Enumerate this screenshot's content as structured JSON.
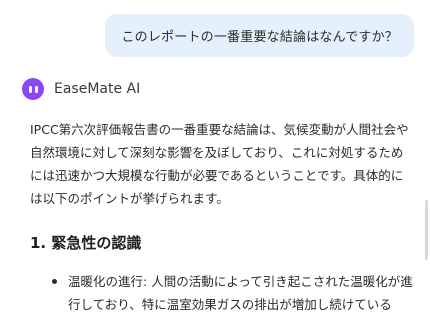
{
  "user_message": "このレポートの一番重要な結論はなんですか？",
  "assistant": {
    "name": "EaseMate AI",
    "answer_paragraph": "IPCC第六次評価報告書の一番重要な結論は、気候変動が人間社会や自然環境に対して深刻な影響を及ぼしており、これに対処するためには迅速かつ大規模な行動が必要であるということです。具体的には以下のポイントが挙げられます。",
    "section_heading": "1. 緊急性の認識",
    "bullets": [
      {
        "label": "温暖化の進行:",
        "text": " 人間の活動によって引き起こされた温暖化が進行しており、特に温室効果ガスの排出が増加し続けている"
      }
    ]
  },
  "colors": {
    "user_bubble_bg": "#e4f0fb",
    "logo_purple": "#8c48f0"
  }
}
